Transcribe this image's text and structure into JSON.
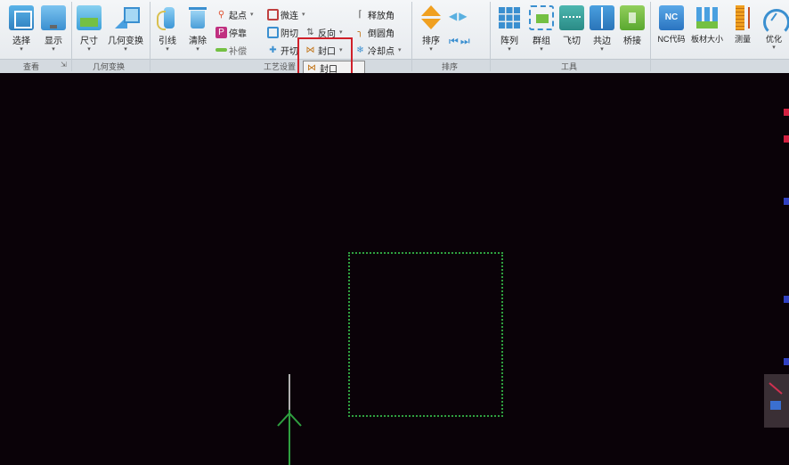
{
  "ribbon": {
    "buttons": {
      "select": "选择",
      "display": "显示",
      "size": "尺寸",
      "geom_transform": "几何变换",
      "lead_line": "引线",
      "clear": "清除",
      "sort": "排序",
      "array": "阵列",
      "group": "群组",
      "fly_cut": "飞切",
      "common_edge": "共边",
      "bridge": "桥接",
      "nc_code": "NC代码",
      "sheet_size": "板材大小",
      "measure": "测量",
      "optimize": "优化"
    },
    "small": {
      "start_point": "起点",
      "stop": "停靠",
      "compensation": "补偿",
      "micro_connect": "微连",
      "shadow_cut": "阴切",
      "reverse": "反向",
      "release_angle": "释放角",
      "round_corner": "倒圆角",
      "cooling_point": "冷却点",
      "open_cut": "开切",
      "seal": "封口"
    },
    "group_labels": {
      "view": "查看",
      "geom_transform": "几何变换",
      "process_settings": "工艺设置",
      "sort": "排序",
      "tools": "工具"
    },
    "tooltip_text": "封口"
  },
  "icons": {
    "select": "select-icon",
    "display": "display-icon",
    "nc": "NC"
  },
  "colors": {
    "highlight_box": "#d0202a",
    "part_outline": "#2fa040",
    "canvas_bg": "#0a0208"
  }
}
